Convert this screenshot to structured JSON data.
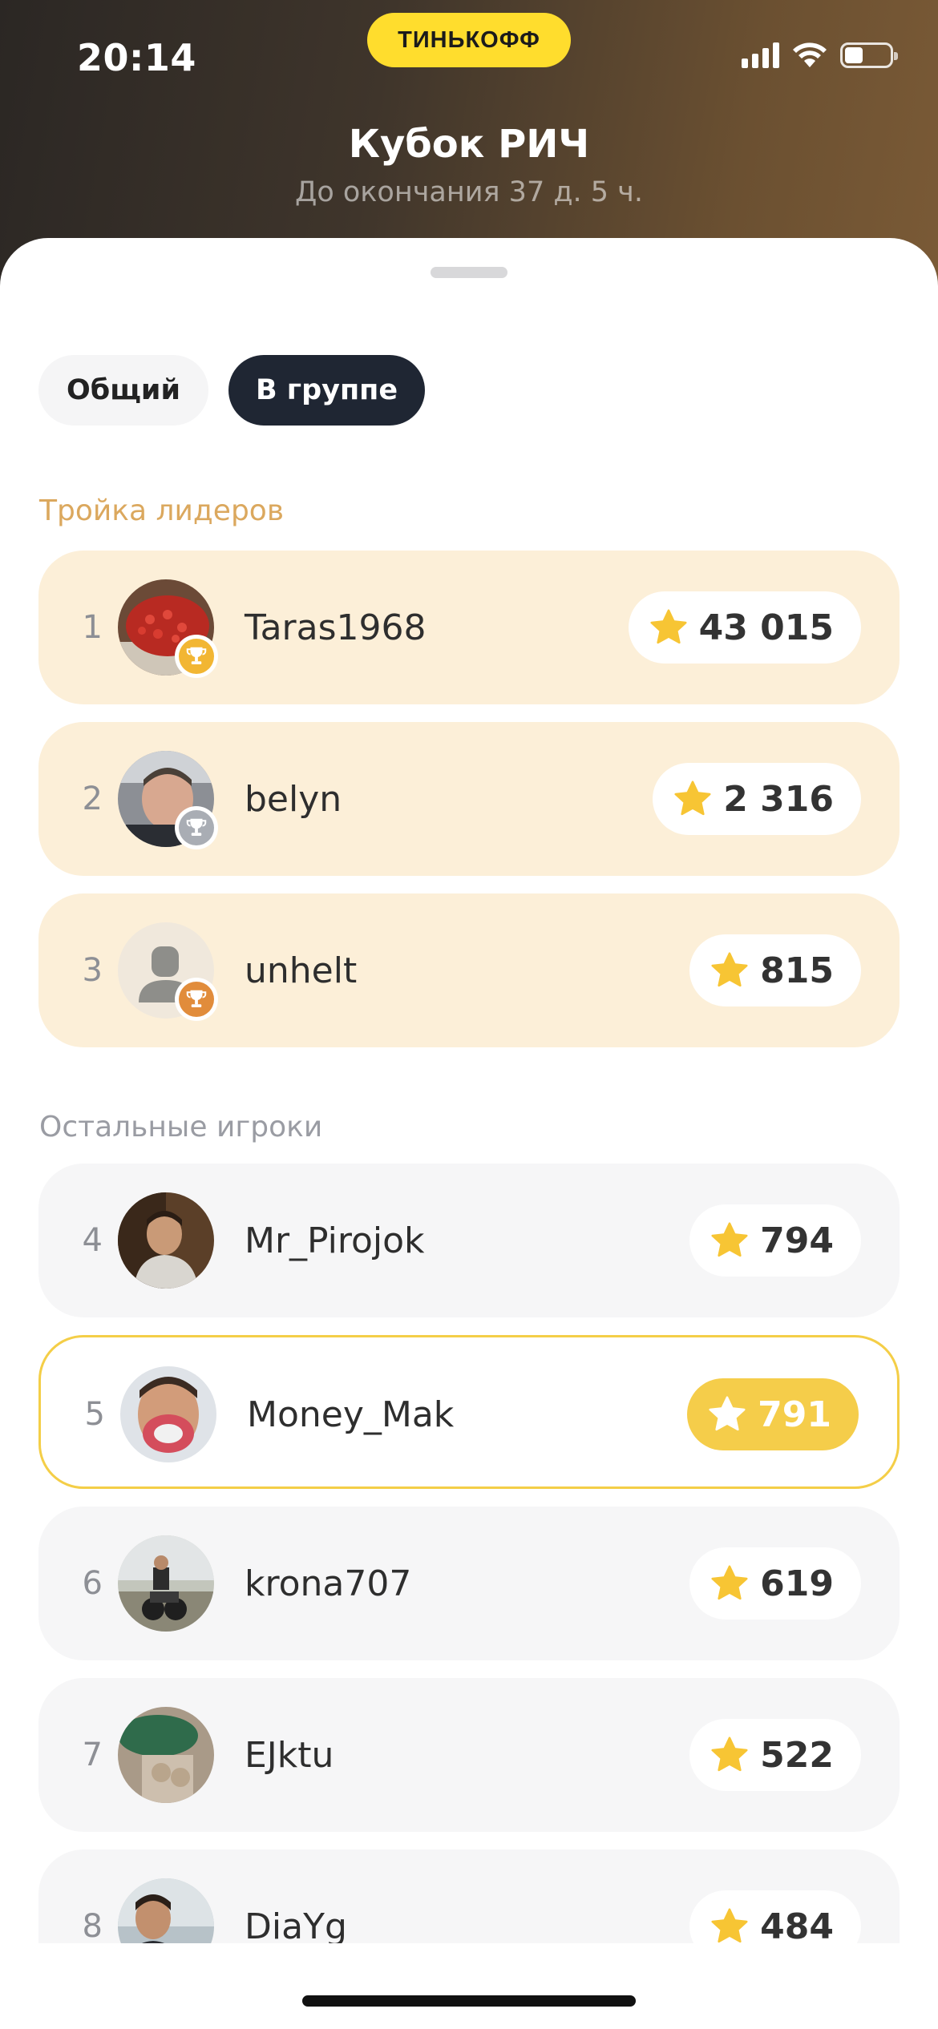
{
  "status_bar": {
    "time": "20:14",
    "brand": "ТИНЬКОФФ",
    "signal_icon": "cellular-signal-icon",
    "wifi_icon": "wifi-icon",
    "battery_icon": "battery-icon",
    "battery_level": 0.4
  },
  "header": {
    "title": "Кубок РИЧ",
    "subtitle": "До окончания 37 д. 5 ч."
  },
  "tabs": [
    {
      "label": "Общий",
      "selected": false
    },
    {
      "label": "В группе",
      "selected": true
    }
  ],
  "sections": {
    "leaders_title": "Тройка лидеров",
    "others_title": "Остальные игроки"
  },
  "leaders": [
    {
      "rank": "1",
      "name": "Taras1968",
      "score": "43 015",
      "medal": "gold-trophy-icon"
    },
    {
      "rank": "2",
      "name": "belyn",
      "score": "2 316",
      "medal": "silver-trophy-icon"
    },
    {
      "rank": "3",
      "name": "unhelt",
      "score": "815",
      "medal": "bronze-trophy-icon"
    }
  ],
  "others": [
    {
      "rank": "4",
      "name": "Mr_Pirojok",
      "score": "794",
      "is_current_user": false
    },
    {
      "rank": "5",
      "name": "Money_Mak",
      "score": "791",
      "is_current_user": true
    },
    {
      "rank": "6",
      "name": "krona707",
      "score": "619",
      "is_current_user": false
    },
    {
      "rank": "7",
      "name": "EJktu",
      "score": "522",
      "is_current_user": false
    },
    {
      "rank": "8",
      "name": "DiaYg",
      "score": "484",
      "is_current_user": false
    }
  ],
  "colors": {
    "brand_yellow": "#ffdd2d",
    "leader_row": "#fcefd8",
    "other_row": "#f6f6f7",
    "current_user_accent": "#f4ce47",
    "star": "#f7c534",
    "gold": "#f2b633",
    "silver": "#a9adb4",
    "bronze": "#e18c3b",
    "leaders_label": "#dba85e",
    "tab_selected": "#1f2633"
  }
}
